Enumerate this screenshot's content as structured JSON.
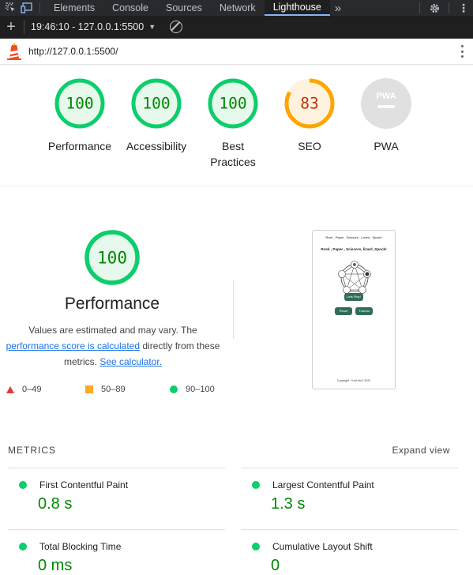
{
  "devtools": {
    "tabs": [
      {
        "label": "Elements"
      },
      {
        "label": "Console"
      },
      {
        "label": "Sources"
      },
      {
        "label": "Network"
      },
      {
        "label": "Lighthouse",
        "active": true
      }
    ],
    "more_tabs_icon": "double-chevron-right-icon"
  },
  "toolbar": {
    "report_selector": "19:46:10 - 127.0.0.1:5500"
  },
  "urlbar": {
    "url": "http://127.0.0.1:5500/"
  },
  "categories": [
    {
      "label": "Performance",
      "score": "100",
      "status": "pass"
    },
    {
      "label": "Accessibility",
      "score": "100",
      "status": "pass"
    },
    {
      "label": "Best Practices",
      "score": "100",
      "status": "pass"
    },
    {
      "label": "SEO",
      "score": "83",
      "status": "average",
      "fraction": 0.83
    },
    {
      "label": "PWA",
      "score": "",
      "status": "na"
    }
  ],
  "pwa_badge": "PWA",
  "performance": {
    "score": "100",
    "title": "Performance",
    "desc_part1": "Values are estimated and may vary. The",
    "link1": "performance score is calculated",
    "desc_part2": "directly from these metrics.",
    "link2": "See calculator."
  },
  "legend": [
    {
      "range": "0–49",
      "shape": "triangle",
      "color": "#e53935"
    },
    {
      "range": "50–89",
      "shape": "square",
      "color": "#ffa726"
    },
    {
      "range": "90–100",
      "shape": "circle",
      "color": "#0cce6b"
    }
  ],
  "screenshot": {
    "heading": "Rock , Paper , Scissors , Lizard , Spock!",
    "title": "Rock , Paper , Scissors, lizard ,Spock!",
    "play_button": "Lets Play!",
    "reset_button": "Reset",
    "tutorial_button": "Tutorial",
    "footer": "Copyright · Karl McG 2022"
  },
  "metrics": {
    "heading": "METRICS",
    "expand": "Expand view",
    "items": [
      {
        "label": "First Contentful Paint",
        "value": "0.8 s"
      },
      {
        "label": "Largest Contentful Paint",
        "value": "1.3 s"
      },
      {
        "label": "Total Blocking Time",
        "value": "0 ms"
      },
      {
        "label": "Cumulative Layout Shift",
        "value": "0"
      }
    ]
  },
  "colors": {
    "pass": "#0cce6b",
    "pass_text": "#008800",
    "pass_fill": "#e7f8ec",
    "average": "#ffa400",
    "average_text": "#c33300",
    "average_fill": "#fff3e0",
    "na": "#e0e0e0"
  }
}
